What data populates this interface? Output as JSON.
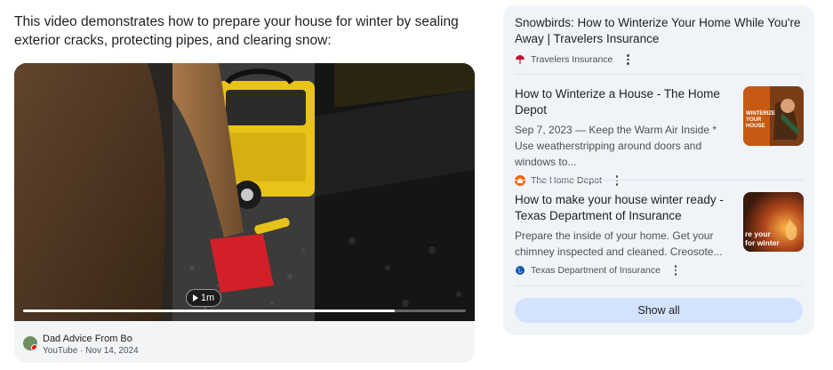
{
  "summary_text": "This video demonstrates how to prepare your house for winter by sealing exterior cracks, protecting pipes, and clearing snow:",
  "video": {
    "duration": "1m",
    "progress": 0.84,
    "channel": "Dad Advice From Bo",
    "source_line": "YouTube · Nov 14, 2024"
  },
  "results": [
    {
      "title": "Snowbirds: How to Winterize Your Home While You're Away | Travelers Insurance",
      "snippet": "",
      "source": "Travelers Insurance",
      "favicon": "umbrella-icon",
      "color": "#c8102e"
    },
    {
      "title": "How to Winterize a House - The Home Depot",
      "snippet": "Sep 7, 2023 — Keep the Warm Air Inside * Use weatherstripping around doors and windows to...",
      "source": "The Home Depot",
      "favicon": "home-depot-icon",
      "color": "#f96302",
      "thumb_text": "WINTERIZE YOUR HOUSE"
    },
    {
      "title": "How to make your house winter ready - Texas Department of Insurance",
      "snippet": "Prepare the inside of your home. Get your chimney inspected and cleaned. Creosote...",
      "source": "Texas Department of Insurance",
      "favicon": "globe-icon",
      "color": "#1a55a6",
      "thumb_text": "re your\nfor winter"
    }
  ],
  "show_all_label": "Show all"
}
